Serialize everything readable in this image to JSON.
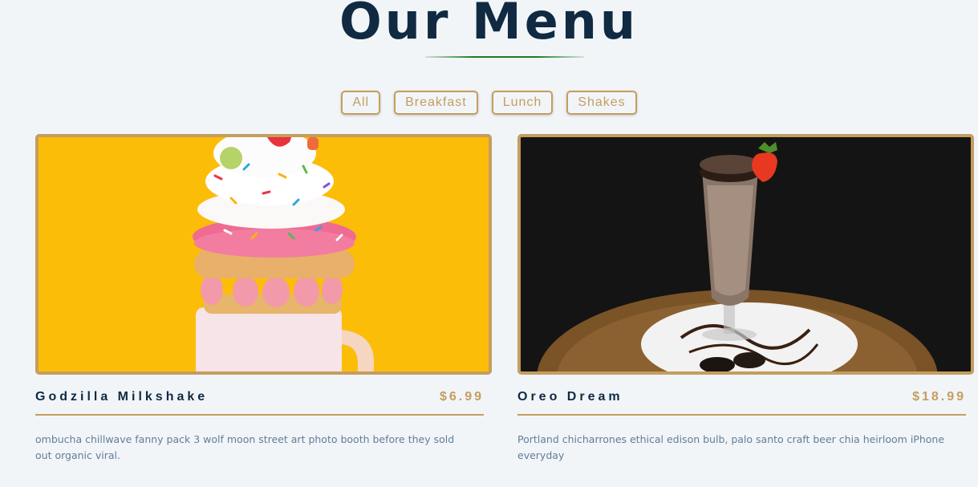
{
  "heading": {
    "title": "Our Menu"
  },
  "filters": [
    "All",
    "Breakfast",
    "Lunch",
    "Shakes"
  ],
  "items": [
    {
      "title": "Godzilla Milkshake",
      "price": "$6.99",
      "description": "ombucha chillwave fanny pack 3 wolf moon street art photo booth before they sold out organic viral."
    },
    {
      "title": "Oreo Dream",
      "price": "$18.99",
      "description": "Portland chicharrones ethical edison bulb, palo santo craft beer chia heirloom iPhone everyday"
    }
  ],
  "colors": {
    "background": "#f1f5f8",
    "accent": "#c59d5f",
    "title": "#102a42",
    "underline": "#1b7d25",
    "text": "#617d98"
  }
}
